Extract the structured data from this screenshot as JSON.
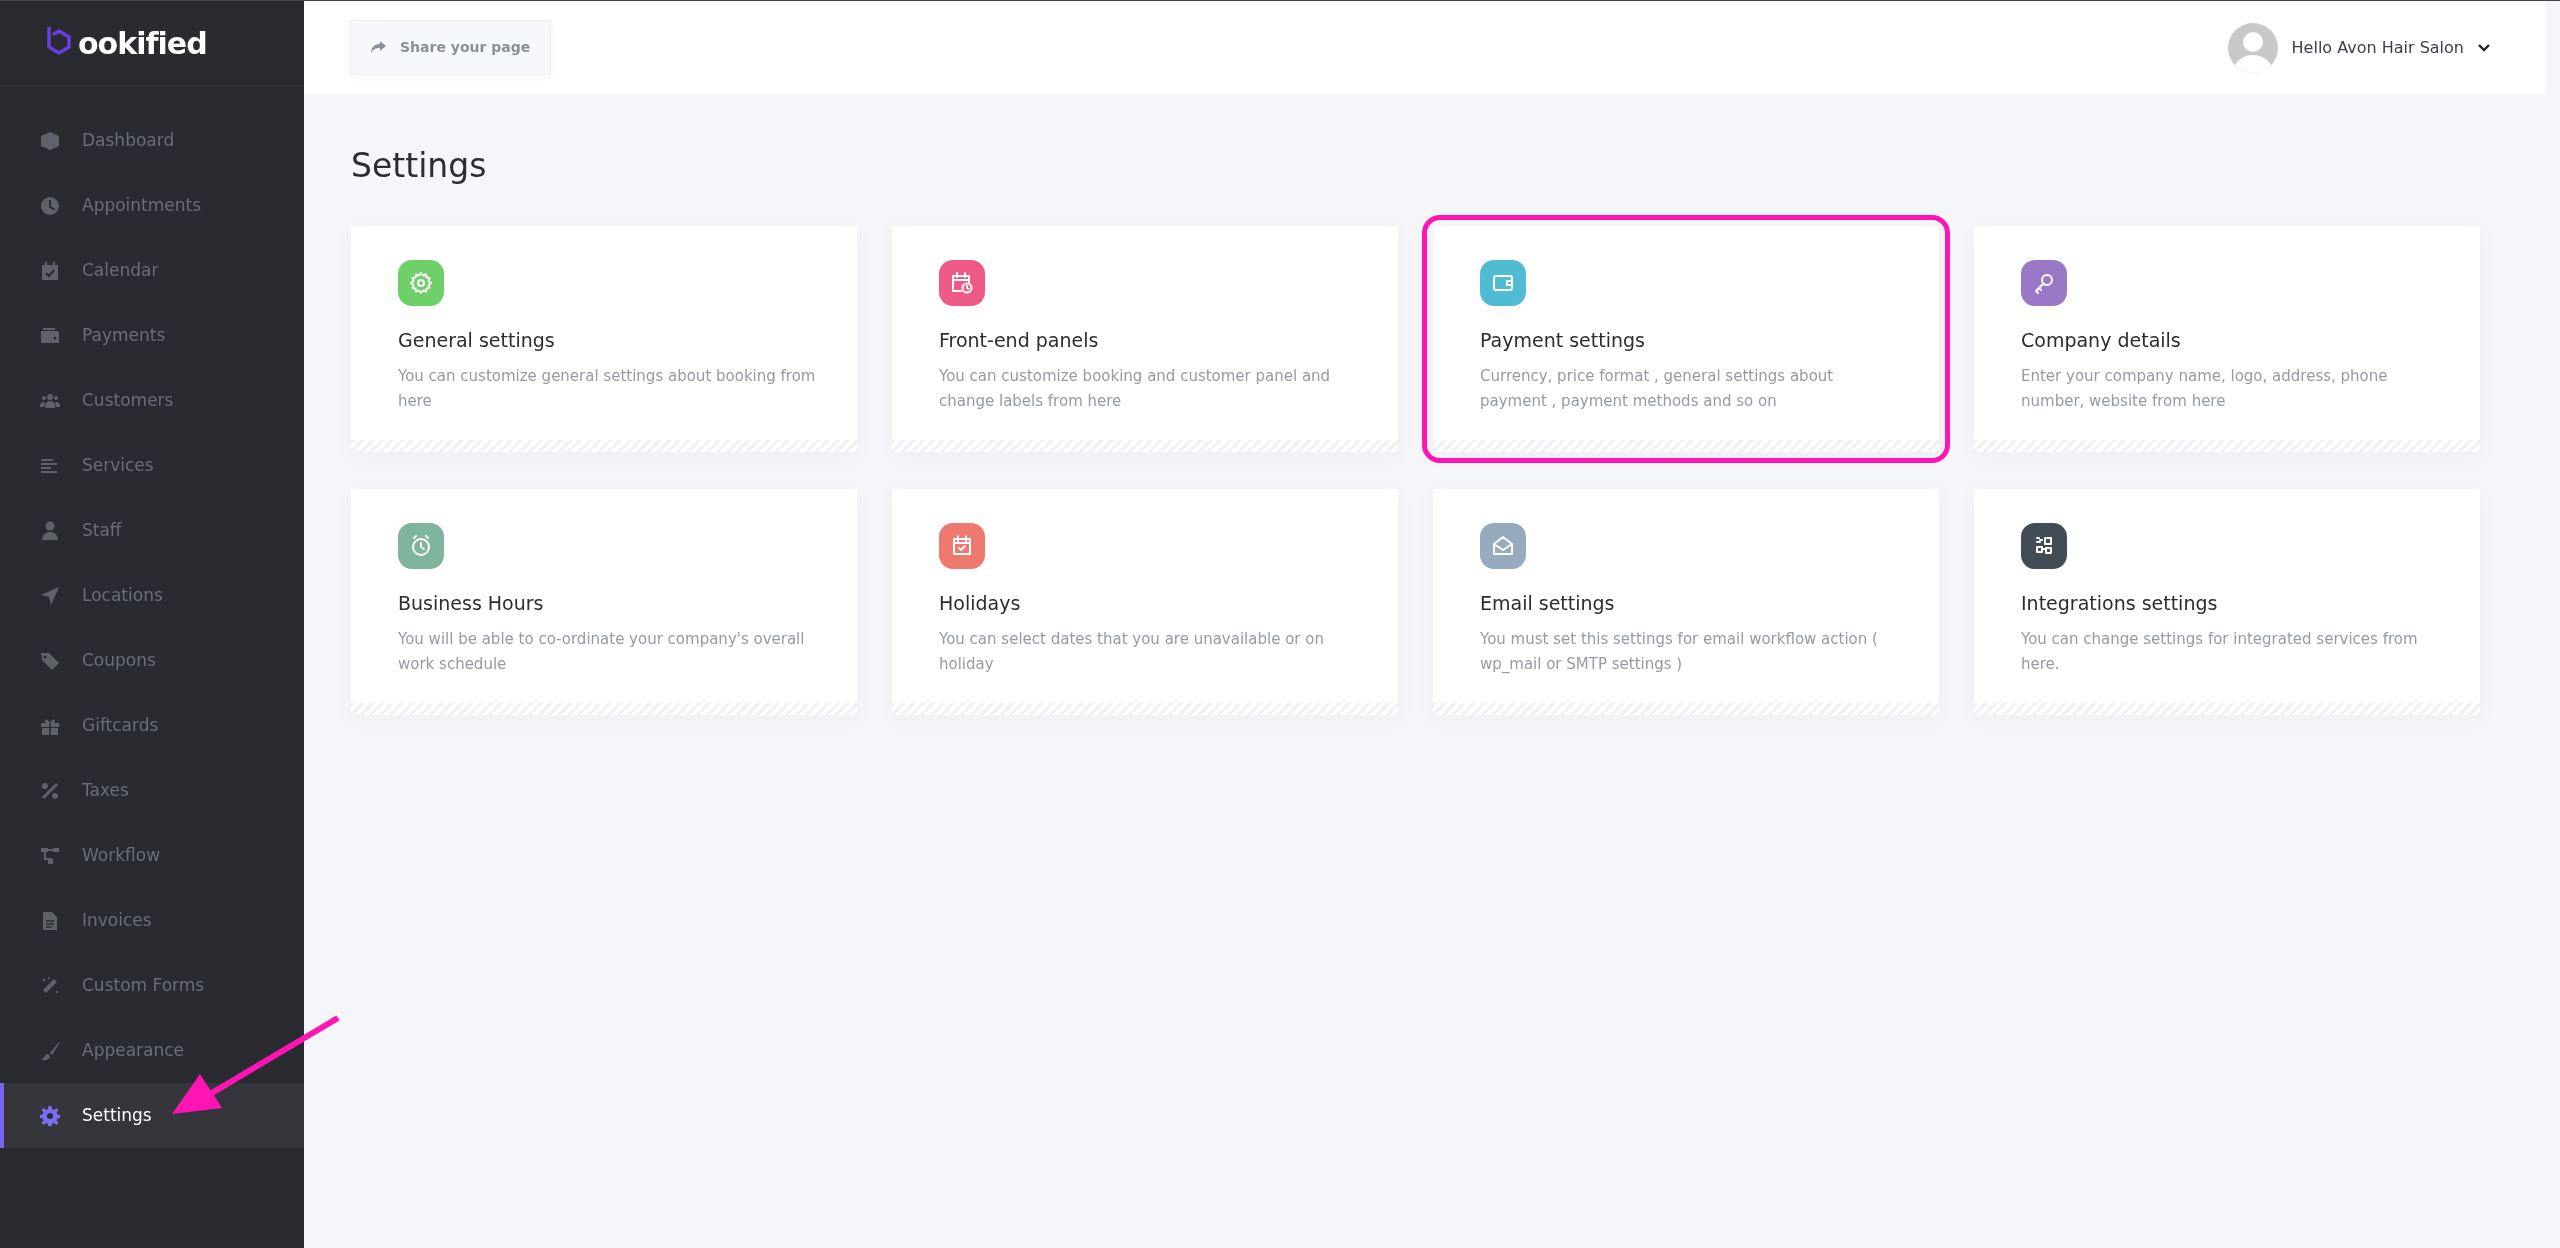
{
  "sidebar": {
    "logo": "ookified",
    "items": [
      {
        "label": "Dashboard",
        "selected": false
      },
      {
        "label": "Appointments",
        "selected": false
      },
      {
        "label": "Calendar",
        "selected": false
      },
      {
        "label": "Payments",
        "selected": false
      },
      {
        "label": "Customers",
        "selected": false
      },
      {
        "label": "Services",
        "selected": false
      },
      {
        "label": "Staff",
        "selected": false
      },
      {
        "label": "Locations",
        "selected": false
      },
      {
        "label": "Coupons",
        "selected": false
      },
      {
        "label": "Giftcards",
        "selected": false
      },
      {
        "label": "Taxes",
        "selected": false
      },
      {
        "label": "Workflow",
        "selected": false
      },
      {
        "label": "Invoices",
        "selected": false
      },
      {
        "label": "Custom Forms",
        "selected": false
      },
      {
        "label": "Appearance",
        "selected": false
      },
      {
        "label": "Settings",
        "selected": true
      }
    ]
  },
  "topbar": {
    "share_button": "Share your page",
    "user_menu": "Hello Avon Hair Salon"
  },
  "page_title": "Settings",
  "cards": [
    {
      "title": "General settings",
      "description": "You can customize general settings about booking from here",
      "color": "#6fd06a",
      "highlighted": false
    },
    {
      "title": "Front-end panels",
      "description": "You can customize booking and customer panel and change labels from here",
      "color": "#ee5a86",
      "highlighted": false
    },
    {
      "title": "Payment settings",
      "description": "Currency, price format , general settings about payment , payment methods and so on",
      "color": "#4fbcd3",
      "highlighted": true
    },
    {
      "title": "Company details",
      "description": "Enter your company name, logo, address, phone number, website from here",
      "color": "#9a78c8",
      "highlighted": false
    },
    {
      "title": "Business Hours",
      "description": "You will be able to co-ordinate your company's overall work schedule",
      "color": "#7fb59d",
      "highlighted": false
    },
    {
      "title": "Holidays",
      "description": "You can select dates that you are unavailable or on holiday",
      "color": "#f0796f",
      "highlighted": false
    },
    {
      "title": "Email settings",
      "description": "You must set this settings for email workflow action ( wp_mail or SMTP settings )",
      "color": "#98abbe",
      "highlighted": false
    },
    {
      "title": "Integrations settings",
      "description": "You can change settings for integrated services from here.",
      "color": "#424c56",
      "highlighted": false
    }
  ],
  "annotation": {
    "arrow_to_selected_item": true
  }
}
